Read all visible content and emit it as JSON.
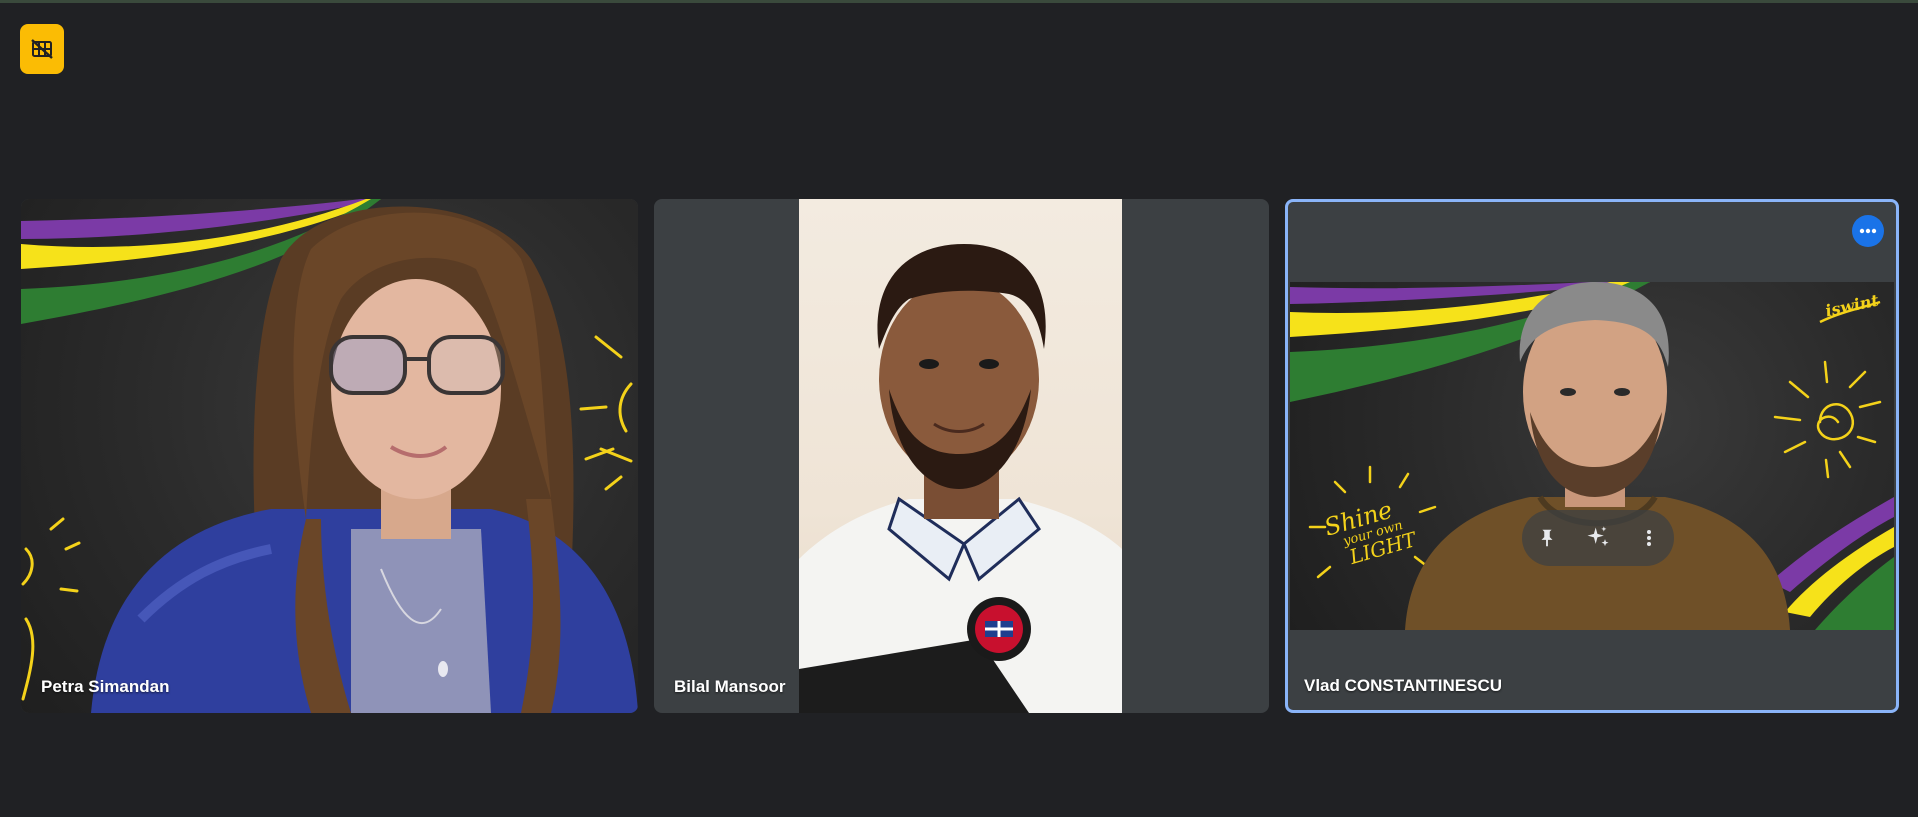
{
  "toolbar": {
    "layout_button_icon": "grid-off-icon",
    "accent_color": "#fbbc04"
  },
  "participants": [
    {
      "name": "Petra Simandan"
    },
    {
      "name": "Bilal Mansoor"
    },
    {
      "name": "Vlad CONSTANTINESCU"
    }
  ],
  "tile_overlay": {
    "more_options_icon": "more-horizontal-icon",
    "hover_actions": [
      {
        "icon": "pin-icon"
      },
      {
        "icon": "sparkle-effects-icon"
      },
      {
        "icon": "more-vertical-icon"
      }
    ]
  },
  "background_text": {
    "tagline_line1": "Shine",
    "tagline_line2": "your own",
    "tagline_line3": "LIGHT",
    "logo": "iswint"
  },
  "colors": {
    "page_bg": "#202124",
    "tile_bg": "#3c4043",
    "active_border": "#8ab4f8",
    "stripe_purple": "#7b3aa6",
    "stripe_yellow": "#f6e21a",
    "stripe_green": "#2e7d32",
    "chalk_yellow": "#f4d21a"
  }
}
